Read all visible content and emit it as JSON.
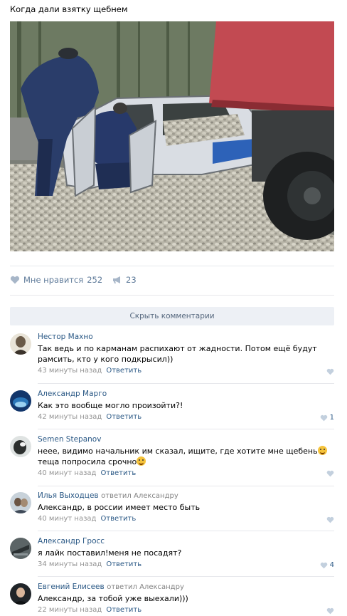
{
  "post": {
    "title": "Когда дали взятку щебнем",
    "likes_label": "Мне нравится",
    "likes_count": "252",
    "shares_count": "23",
    "hide_comments": "Скрыть комментарии"
  },
  "comments": [
    {
      "author": "Нестор Махно",
      "reply_to": "",
      "text_lines": [
        "Так ведь и по карманам распихают от жадности. Потом ещё будут",
        "рамсить, кто у кого подкрысил))"
      ],
      "time": "43 минуты назад",
      "reply_label": "Ответить",
      "likes": ""
    },
    {
      "author": "Александр Марго",
      "reply_to": "",
      "text_lines": [
        "Как это вообще могло произойти?!"
      ],
      "time": "42 минуты назад",
      "reply_label": "Ответить",
      "likes": "1"
    },
    {
      "author": "Semen Stepanov",
      "reply_to": "",
      "text_lines": [
        "неее, видимо начальник им сказал, ищите, где хотите мне щебень",
        "теща попросила срочно"
      ],
      "time": "40 минут назад",
      "reply_label": "Ответить",
      "likes": ""
    },
    {
      "author": "Илья Выходцев",
      "reply_to": "ответил Александру",
      "text_lines": [
        "Александр, в россии имеет место быть"
      ],
      "time": "40 минут назад",
      "reply_label": "Ответить",
      "likes": ""
    },
    {
      "author": "Александр Гросс",
      "reply_to": "",
      "text_lines": [
        "я лайк поставил!меня не посадят?"
      ],
      "time": "34 минуты назад",
      "reply_label": "Ответить",
      "likes": "4"
    },
    {
      "author": "Евгений Елисеев",
      "reply_to": "ответил Александру",
      "text_lines": [
        "Александр, за тобой уже выехали)))"
      ],
      "time": "22 минуты назад",
      "reply_label": "Ответить",
      "likes": ""
    }
  ],
  "colors": {
    "link": "#2a5885",
    "action": "#5e7a99",
    "muted": "#939393",
    "button_bg": "#edf0f5"
  }
}
